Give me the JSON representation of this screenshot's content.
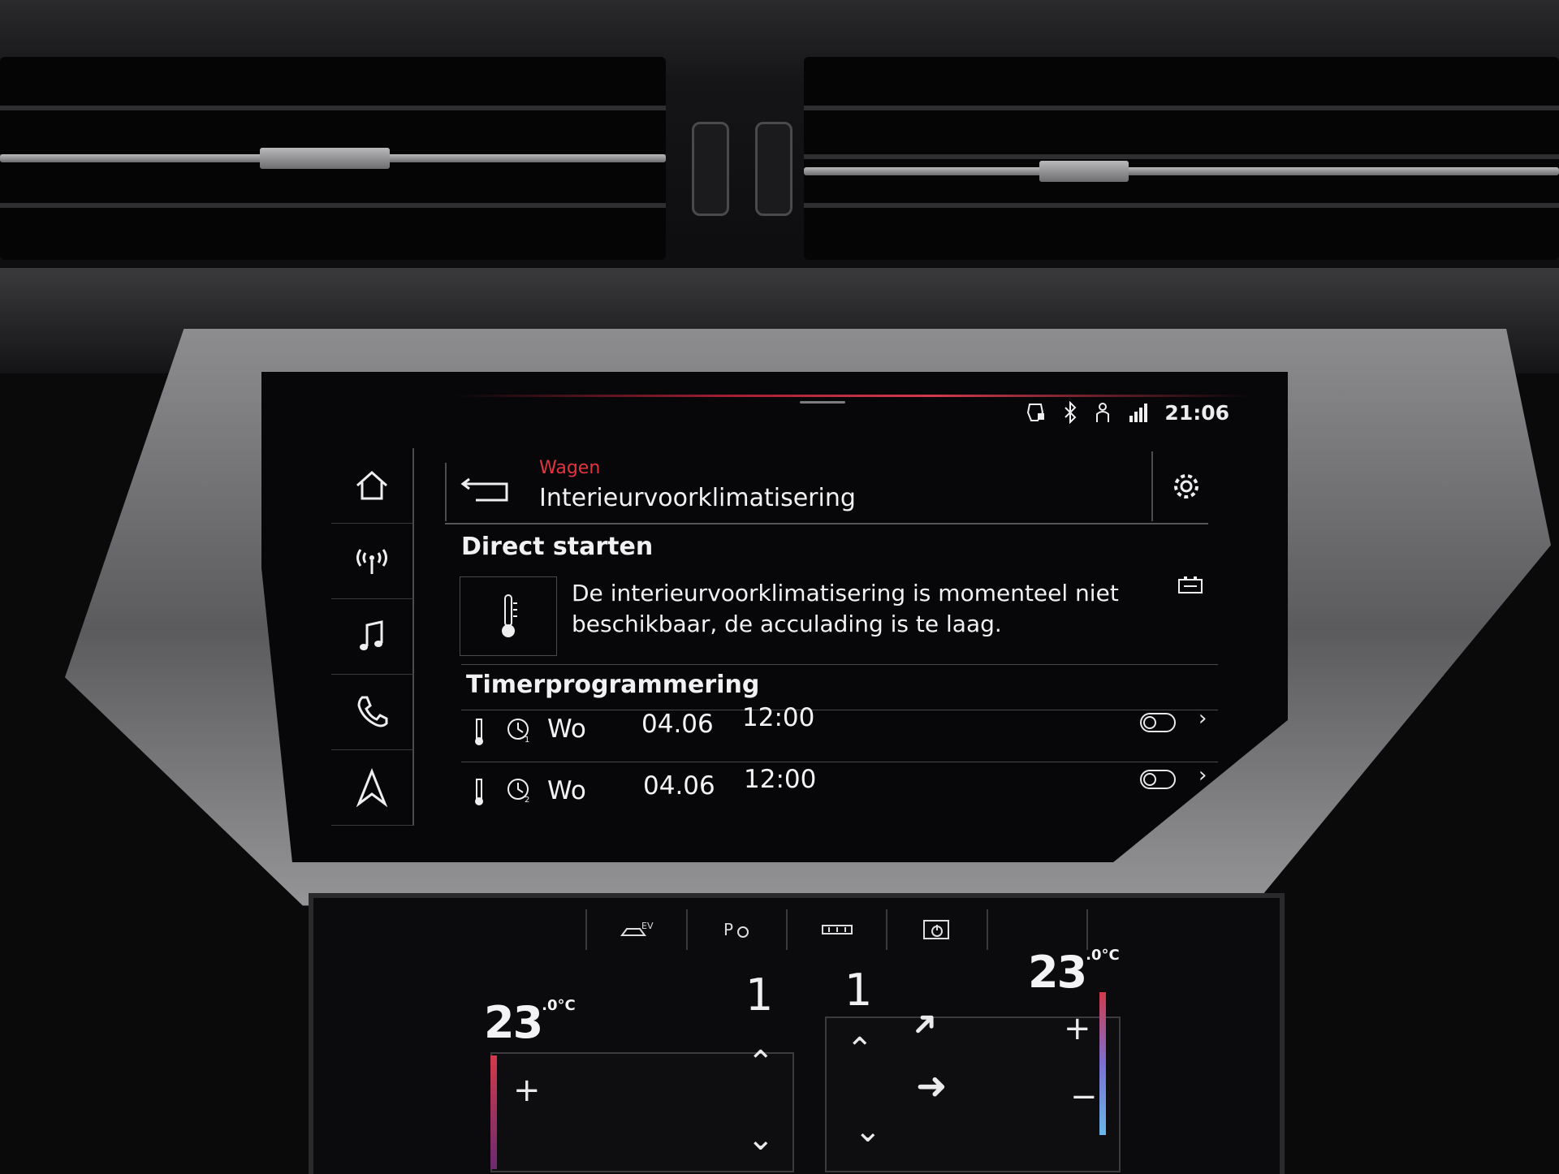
{
  "status": {
    "time": "21:06",
    "icons": [
      "car-lock-icon",
      "bluetooth-icon",
      "person-icon",
      "signal-icon"
    ]
  },
  "sidebar": {
    "items": [
      {
        "name": "home-icon"
      },
      {
        "name": "radio-icon"
      },
      {
        "name": "music-icon"
      },
      {
        "name": "phone-icon"
      },
      {
        "name": "navigation-icon"
      }
    ]
  },
  "header": {
    "breadcrumb": "Wagen",
    "title": "Interieurvoorklimatisering"
  },
  "direct_start": {
    "title": "Direct starten",
    "message": "De interieurvoorklimatisering is momenteel niet beschikbaar, de acculading is te laag."
  },
  "timers": {
    "title": "Timerprogrammering",
    "rows": [
      {
        "day": "Wo",
        "date": "04.06",
        "time": "12:00",
        "timer_no": "1",
        "enabled": false
      },
      {
        "day": "Wo",
        "date": "04.06",
        "time": "12:00",
        "timer_no": "2",
        "enabled": false
      }
    ]
  },
  "climate": {
    "left_temp": "23",
    "left_decimal": ".0",
    "right_temp": "23",
    "right_decimal": ".0",
    "unit": "°C",
    "left_fan": "1",
    "right_fan": "1",
    "tab_ev": "EV",
    "accent": "#e3353f"
  }
}
